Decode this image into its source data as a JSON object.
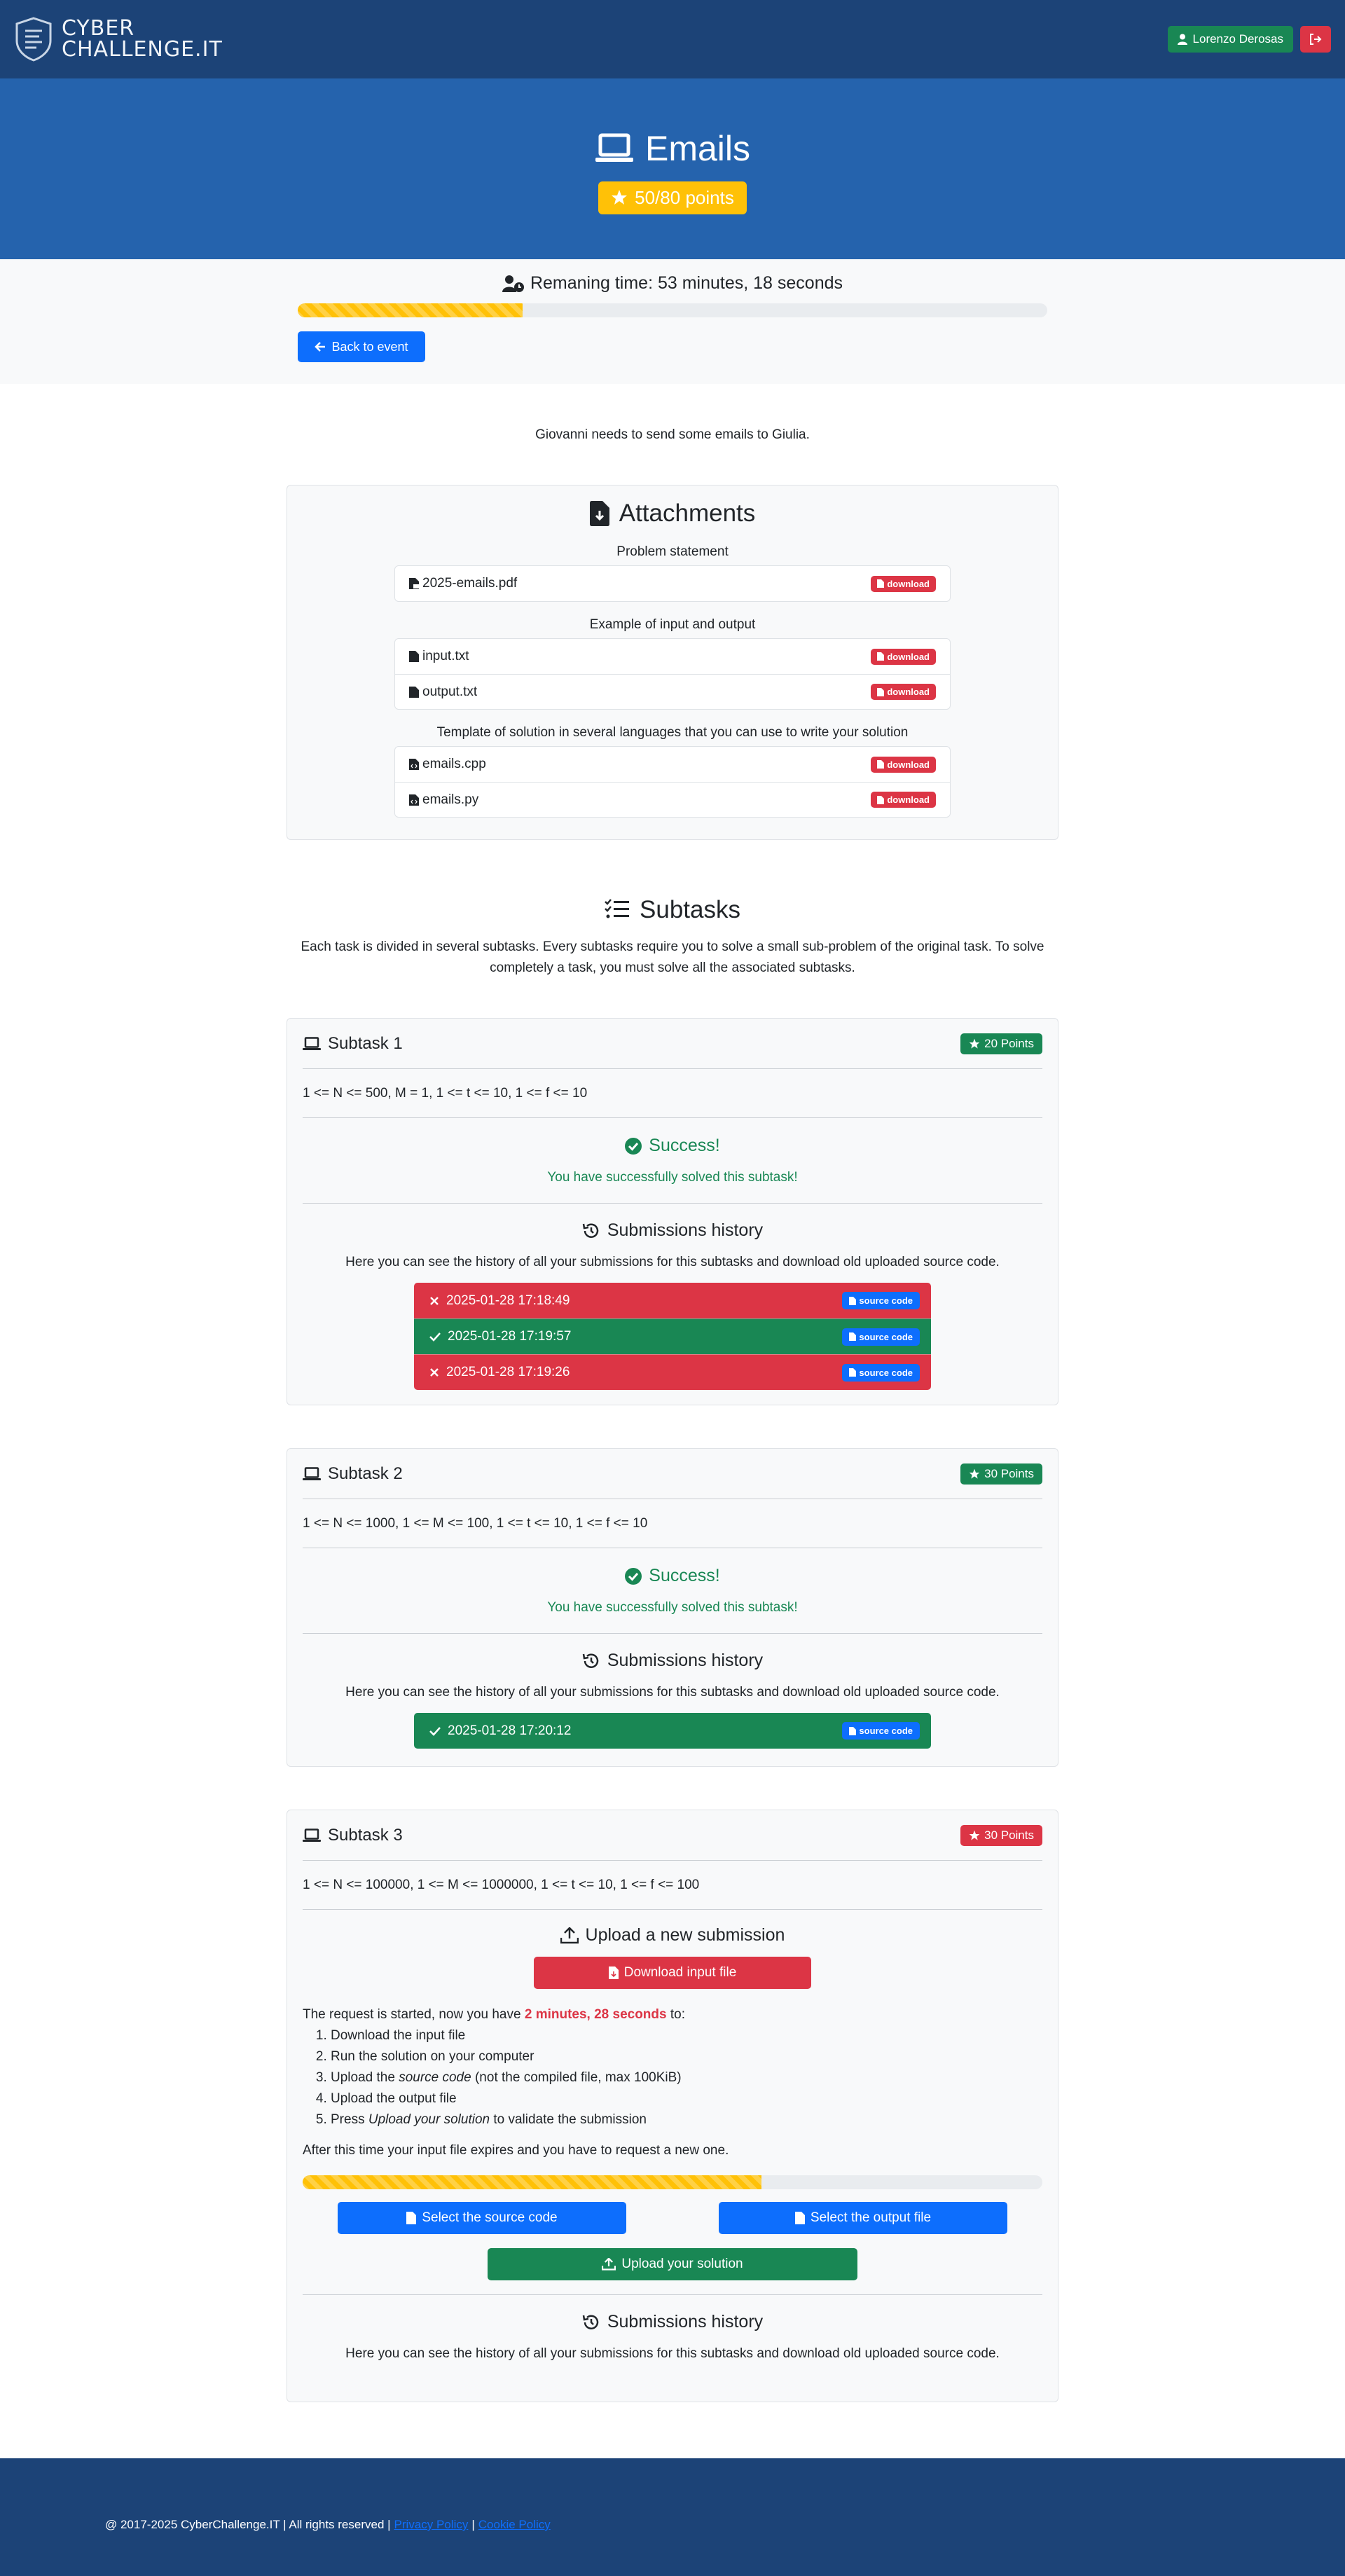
{
  "brand": {
    "line1": "CYBER",
    "line2": "CHALLENGE.IT"
  },
  "user": {
    "name": "Lorenzo Derosas"
  },
  "hero": {
    "title": "Emails",
    "points": "50/80 points"
  },
  "timer": {
    "text": "Remaning time: 53 minutes, 18 seconds",
    "progress_fraction": 0.3
  },
  "back_label": "Back to event",
  "intro": "Giovanni needs to send some emails to Giulia.",
  "attachments": {
    "title": "Attachments",
    "groups": [
      {
        "title": "Problem statement",
        "files": [
          "2025-emails.pdf"
        ]
      },
      {
        "title": "Example of input and output",
        "files": [
          "input.txt",
          "output.txt"
        ]
      },
      {
        "title": "Template of solution in several languages that you can use to write your solution",
        "files": [
          "emails.cpp",
          "emails.py"
        ]
      }
    ],
    "download_label": "download"
  },
  "subtasks_section": {
    "title": "Subtasks",
    "description": "Each task is divided in several subtasks. Every subtasks require you to solve a small sub-problem of the original task. To solve completely a task, you must solve all the associated subtasks."
  },
  "subtasks": [
    {
      "title": "Subtask 1",
      "points": "20 Points",
      "points_color": "#198754",
      "constraint": "1 <= N <= 500, M = 1, 1 <= t <= 10, 1 <= f <= 10",
      "success_title": "Success!",
      "success_text": "You have successfully solved this subtask!",
      "history_title": "Submissions history",
      "history_desc": "Here you can see the history of all your submissions for this subtasks and download old uploaded source code.",
      "submissions": [
        {
          "time": "2025-01-28 17:18:49",
          "status": "fail"
        },
        {
          "time": "2025-01-28 17:19:57",
          "status": "ok"
        },
        {
          "time": "2025-01-28 17:19:26",
          "status": "fail"
        }
      ]
    },
    {
      "title": "Subtask 2",
      "points": "30 Points",
      "points_color": "#198754",
      "constraint": "1 <= N <= 1000, 1 <= M <= 100, 1 <= t <= 10, 1 <= f <= 10",
      "success_title": "Success!",
      "success_text": "You have successfully solved this subtask!",
      "history_title": "Submissions history",
      "history_desc": "Here you can see the history of all your submissions for this subtasks and download old uploaded source code.",
      "submissions": [
        {
          "time": "2025-01-28 17:20:12",
          "status": "ok"
        }
      ]
    },
    {
      "title": "Subtask 3",
      "points": "30 Points",
      "points_color": "#dc3545",
      "constraint": "1 <= N <= 100000, 1 <= M <= 1000000, 1 <= t <= 10, 1 <= f <= 100",
      "upload_title": "Upload a new submission",
      "download_input": "Download input file",
      "request_prefix": "The request is started, now you have",
      "request_time": "2 minutes, 28 seconds",
      "request_suffix": "to:",
      "steps": [
        "Download the input file",
        "Run the solution on your computer",
        "Upload the ",
        "Upload the output file",
        "Press "
      ],
      "step3_em": "source code",
      "step3_rest": " (not the compiled file, max 100KiB)",
      "step5_em": "Upload your solution",
      "step5_rest": " to validate the submission",
      "expire_text": "After this time your input file expires and you have to request a new one.",
      "progress_fraction": 0.62,
      "select_source": "Select the source code",
      "select_output": "Select the output file",
      "upload_button": "Upload your solution",
      "history_title": "Submissions history",
      "history_desc": "Here you can see the history of all your submissions for this subtasks and download old uploaded source code."
    }
  ],
  "source_code_label": "source code",
  "footer": {
    "copyright": "@ 2017-2025 CyberChallenge.IT | All rights reserved |",
    "privacy": "Privacy Policy",
    "sep": "|",
    "cookie": "Cookie Policy"
  },
  "colors": {
    "navbar": "#1c4377",
    "hero": "#2563ad",
    "warning": "#ffc107",
    "success": "#198754",
    "danger": "#dc3545",
    "primary": "#0d6efd"
  }
}
